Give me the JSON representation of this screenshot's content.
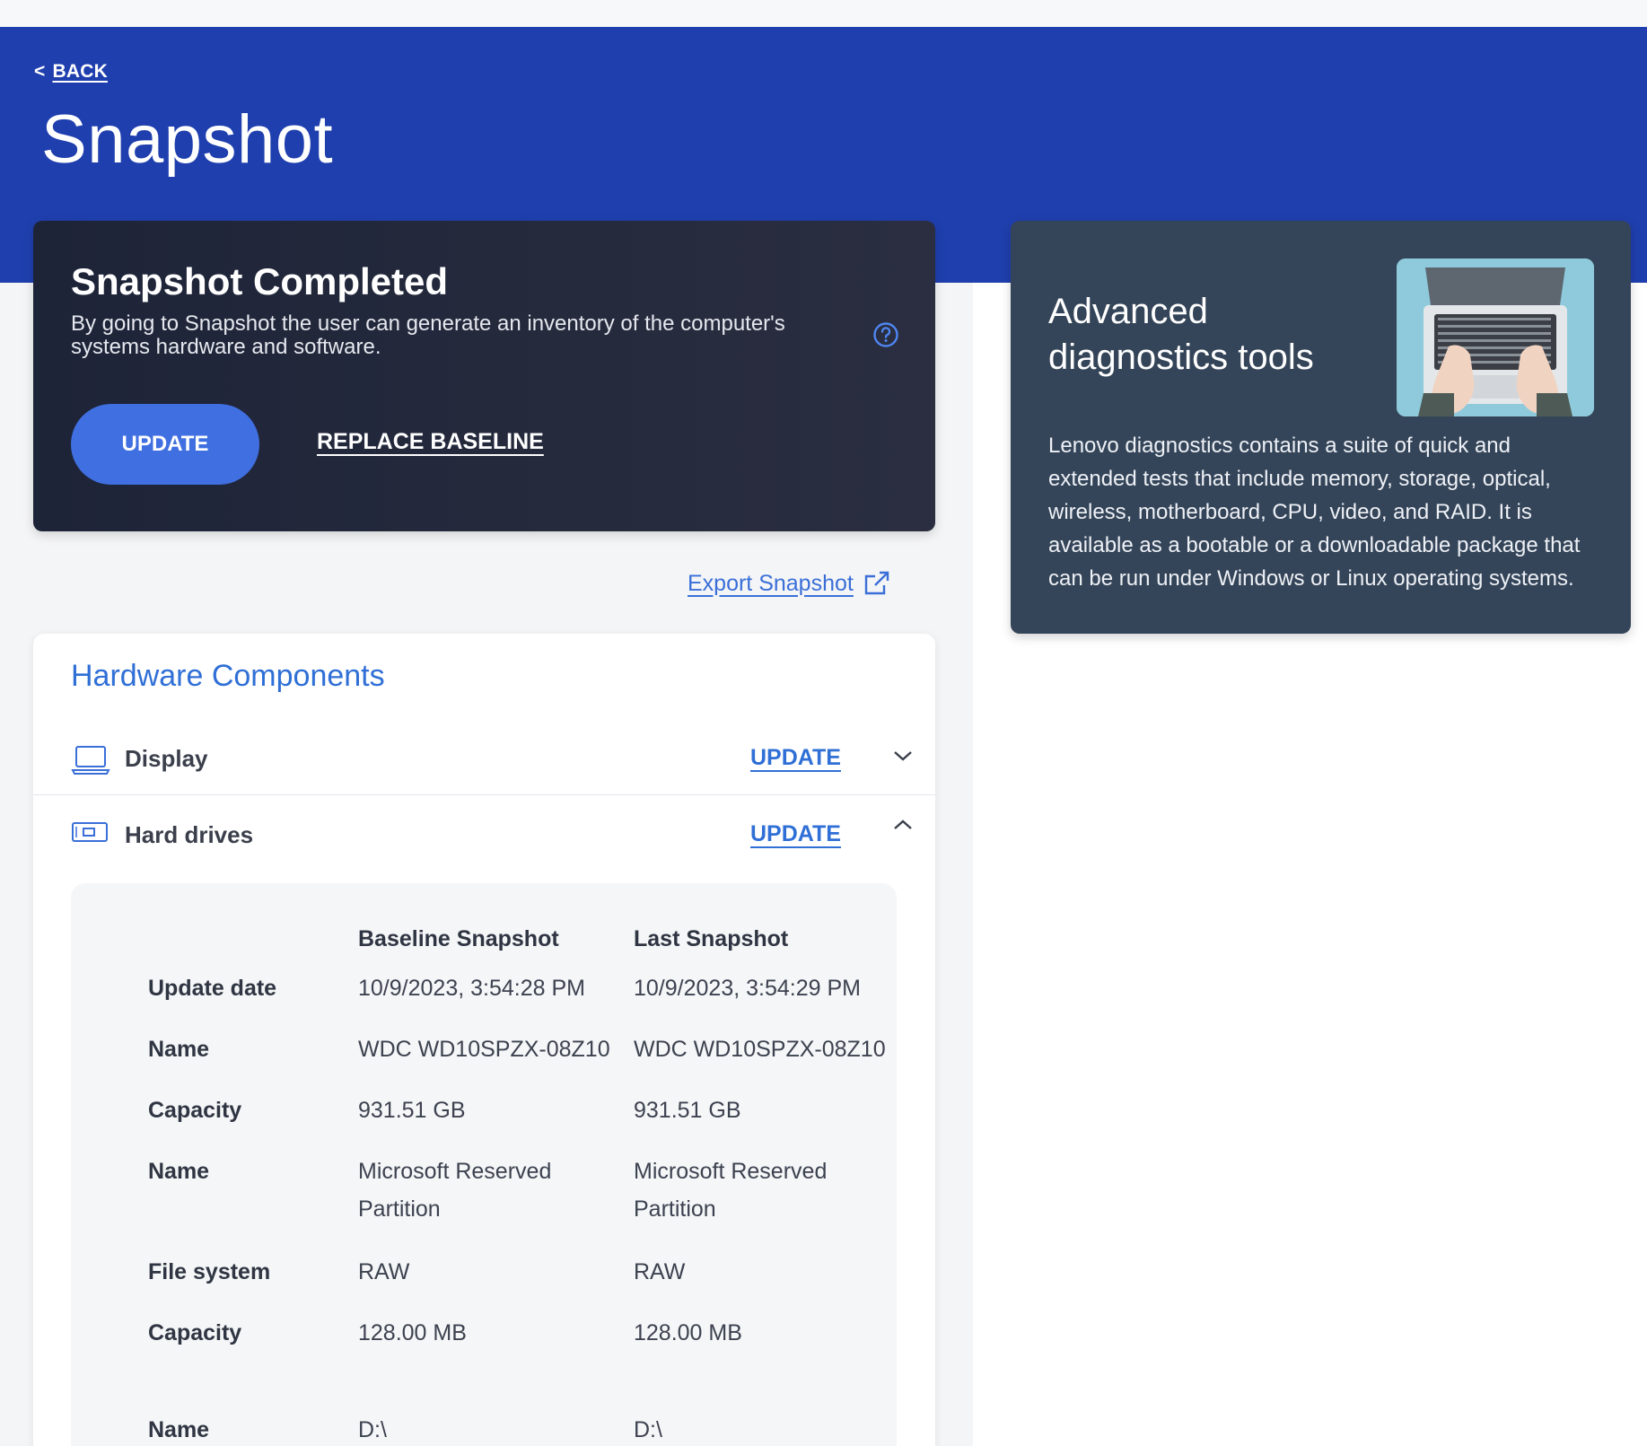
{
  "header": {
    "back_label": "BACK",
    "back_chevron": "<",
    "title": "Snapshot"
  },
  "status_card": {
    "title": "Snapshot Completed",
    "description": "By going to Snapshot the user can generate an inventory of the computer's systems hardware and software.",
    "update_label": "UPDATE",
    "replace_label": "REPLACE BASELINE",
    "help_icon": "question-circle-icon"
  },
  "export": {
    "label": "Export Snapshot",
    "icon": "external-link-icon"
  },
  "hardware": {
    "title": "Hardware Components",
    "rows": [
      {
        "label": "Display",
        "update_label": "UPDATE",
        "icon": "laptop-icon",
        "expanded": false
      },
      {
        "label": "Hard drives",
        "update_label": "UPDATE",
        "icon": "hard-drive-icon",
        "expanded": true
      }
    ],
    "details": {
      "headers": [
        "Baseline Snapshot",
        "Last Snapshot"
      ],
      "rows": [
        {
          "label": "Update date",
          "baseline": "10/9/2023, 3:54:28 PM",
          "last": "10/9/2023, 3:54:29 PM"
        },
        {
          "label": "Name",
          "baseline": "WDC WD10SPZX-08Z10",
          "last": "WDC WD10SPZX-08Z10"
        },
        {
          "label": "Capacity",
          "baseline": "931.51 GB",
          "last": "931.51 GB"
        },
        {
          "label": "Name",
          "baseline": "Microsoft Reserved Partition",
          "last": "Microsoft Reserved Partition"
        },
        {
          "label": "File system",
          "baseline": "RAW",
          "last": "RAW"
        },
        {
          "label": "Capacity",
          "baseline": "128.00 MB",
          "last": "128.00 MB"
        },
        {
          "label": "Name",
          "baseline": "D:\\",
          "last": "D:\\"
        }
      ]
    }
  },
  "diagnostics": {
    "title": "Advanced diagnostics tools",
    "text": "Lenovo diagnostics contains a suite of quick and extended tests that include memory, storage, optical, wireless, motherboard, CPU, video, and RAID. It is available as a bootable or a downloadable package that can be run under Windows or Linux operating systems."
  },
  "colors": {
    "banner": "#1f3fae",
    "accent": "#2f6fd6",
    "button": "#3f6fe0",
    "status_card": "#1e2438",
    "diag_card": "#354559"
  }
}
